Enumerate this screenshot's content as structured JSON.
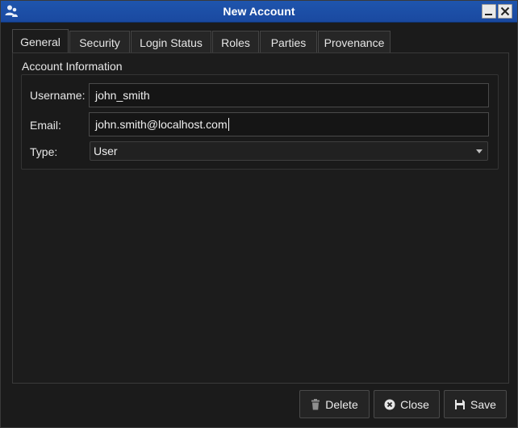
{
  "window": {
    "title": "New Account"
  },
  "tabs": [
    {
      "label": "General",
      "active": true
    },
    {
      "label": "Security"
    },
    {
      "label": "Login Status"
    },
    {
      "label": "Roles"
    },
    {
      "label": "Parties"
    },
    {
      "label": "Provenance"
    }
  ],
  "account_info": {
    "group_title": "Account Information",
    "username_label": "Username:",
    "username_value": "john_smith",
    "email_label": "Email:",
    "email_value": "john.smith@localhost.com",
    "type_label": "Type:",
    "type_value": "User"
  },
  "buttons": {
    "delete": "Delete",
    "close": "Close",
    "save": "Save"
  },
  "colors": {
    "titlebar": "#1f55ad",
    "background": "#1b1b1b"
  },
  "icons": {
    "app": "users-icon",
    "minimize": "minimize-icon",
    "close_window": "close-icon",
    "delete": "trash-icon",
    "close": "close-circle-icon",
    "save": "save-icon",
    "dropdown": "chevron-down-icon"
  }
}
